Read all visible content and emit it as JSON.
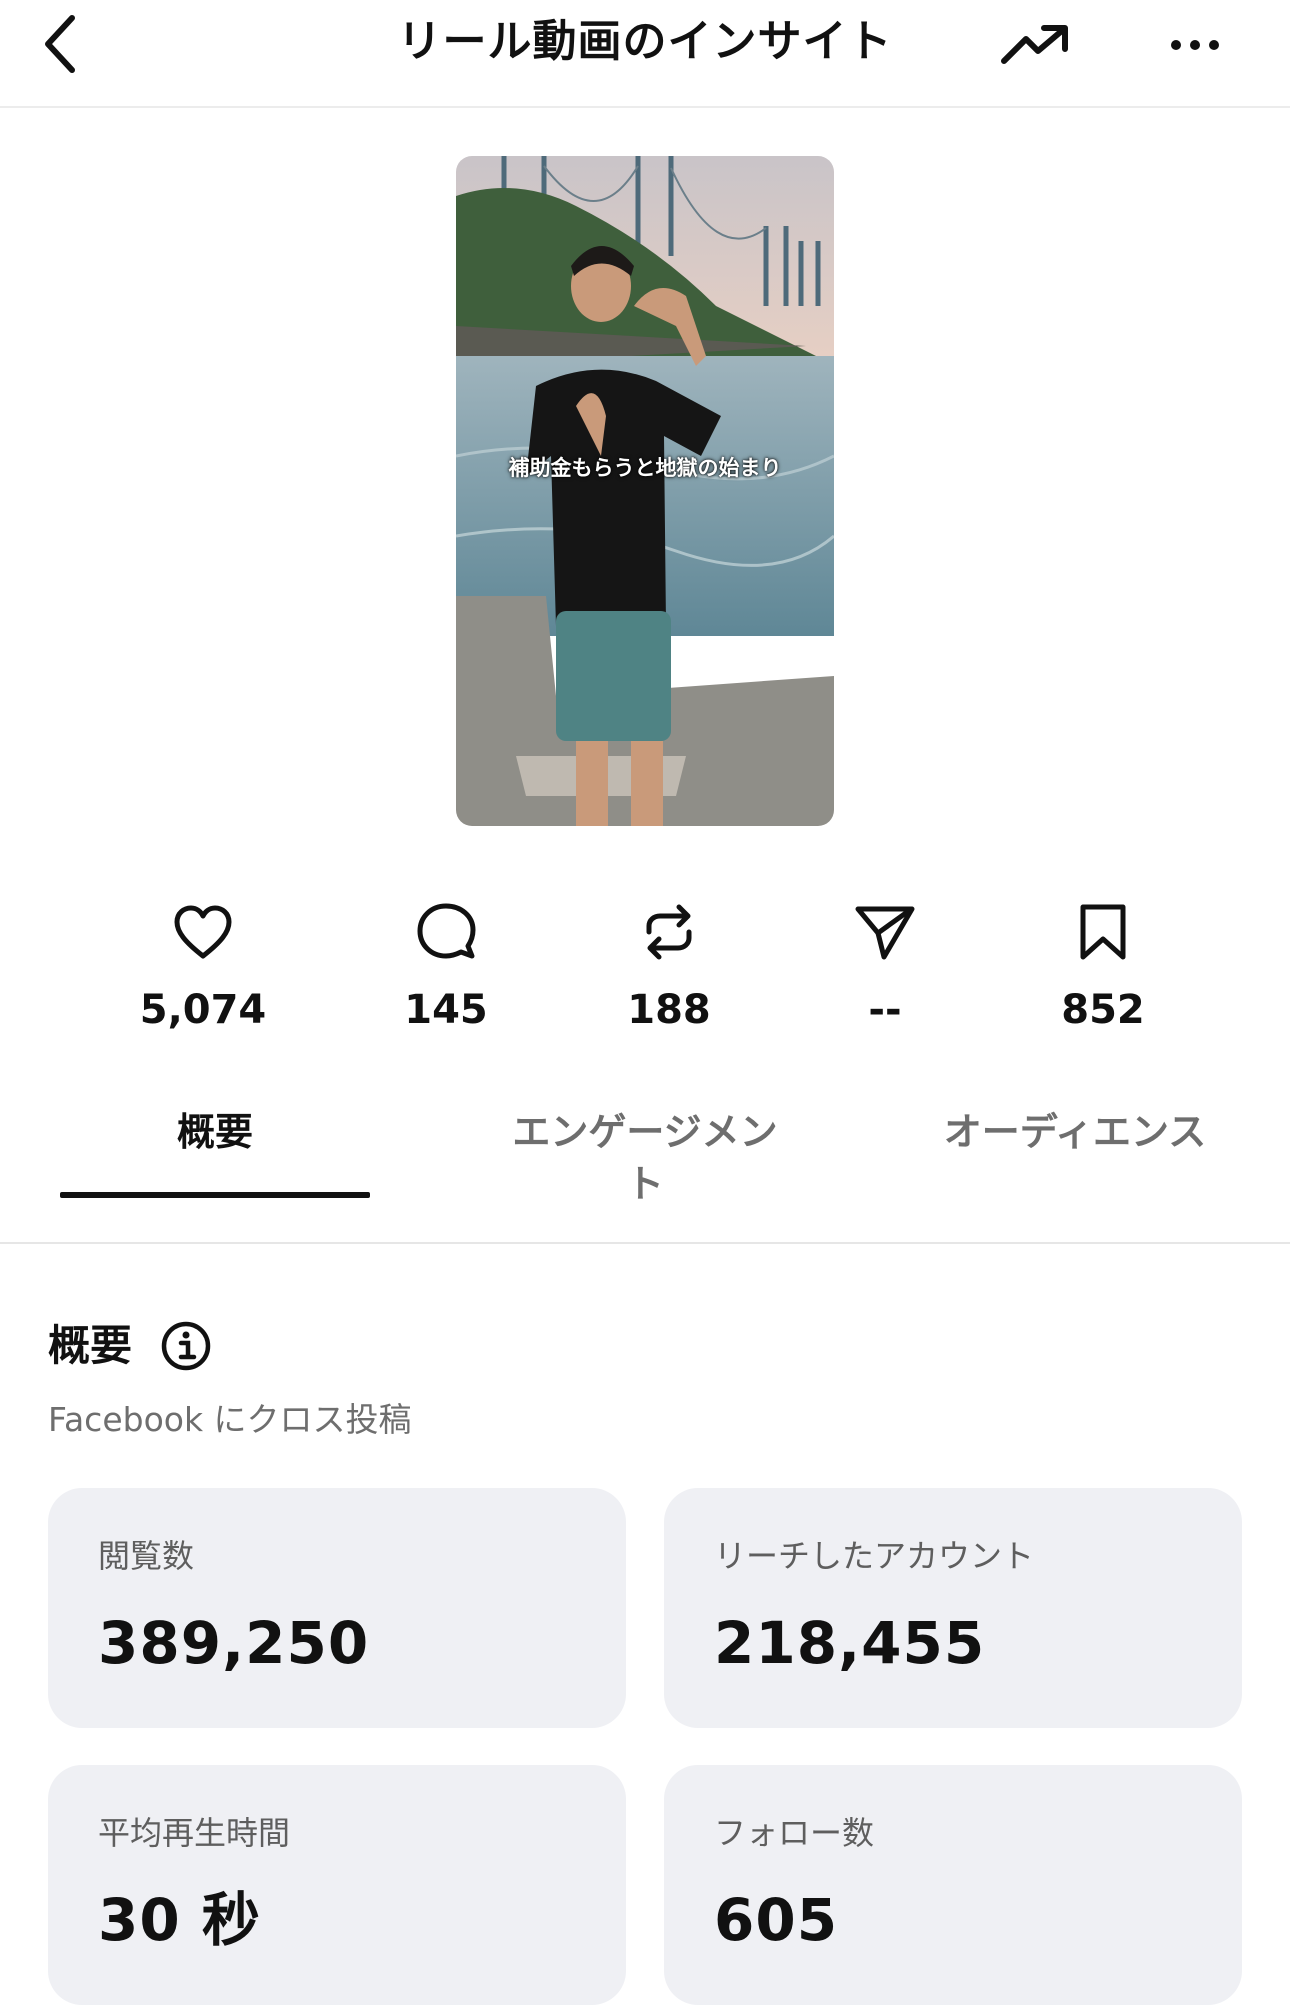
{
  "header": {
    "title": "リール動画のインサイト",
    "back_icon": "chevron-left-icon",
    "trend_icon": "trending-up-icon",
    "more_icon": "more-horizontal-icon"
  },
  "reel": {
    "caption": "補助金もらうと地獄の始まり"
  },
  "stats": [
    {
      "icon": "heart-icon",
      "value": "5,074"
    },
    {
      "icon": "comment-icon",
      "value": "145"
    },
    {
      "icon": "repost-icon",
      "value": "188"
    },
    {
      "icon": "share-icon",
      "value": "--"
    },
    {
      "icon": "bookmark-icon",
      "value": "852"
    }
  ],
  "tabs": [
    {
      "label": "概要",
      "active": true
    },
    {
      "label": "エンゲージメン\nト",
      "active": false
    },
    {
      "label": "オーディエンス",
      "active": false
    }
  ],
  "overview": {
    "title": "概要",
    "subtitle": "Facebook にクロス投稿",
    "cards": [
      {
        "label": "閲覧数",
        "value": "389,250"
      },
      {
        "label": "リーチしたアカウント",
        "value": "218,455"
      },
      {
        "label": "平均再生時間",
        "value": "30 秒"
      },
      {
        "label": "フォロー数",
        "value": "605"
      }
    ]
  },
  "colors": {
    "card_bg": "#eff0f4",
    "text_primary": "#111111",
    "text_secondary": "#6e6e6e"
  }
}
